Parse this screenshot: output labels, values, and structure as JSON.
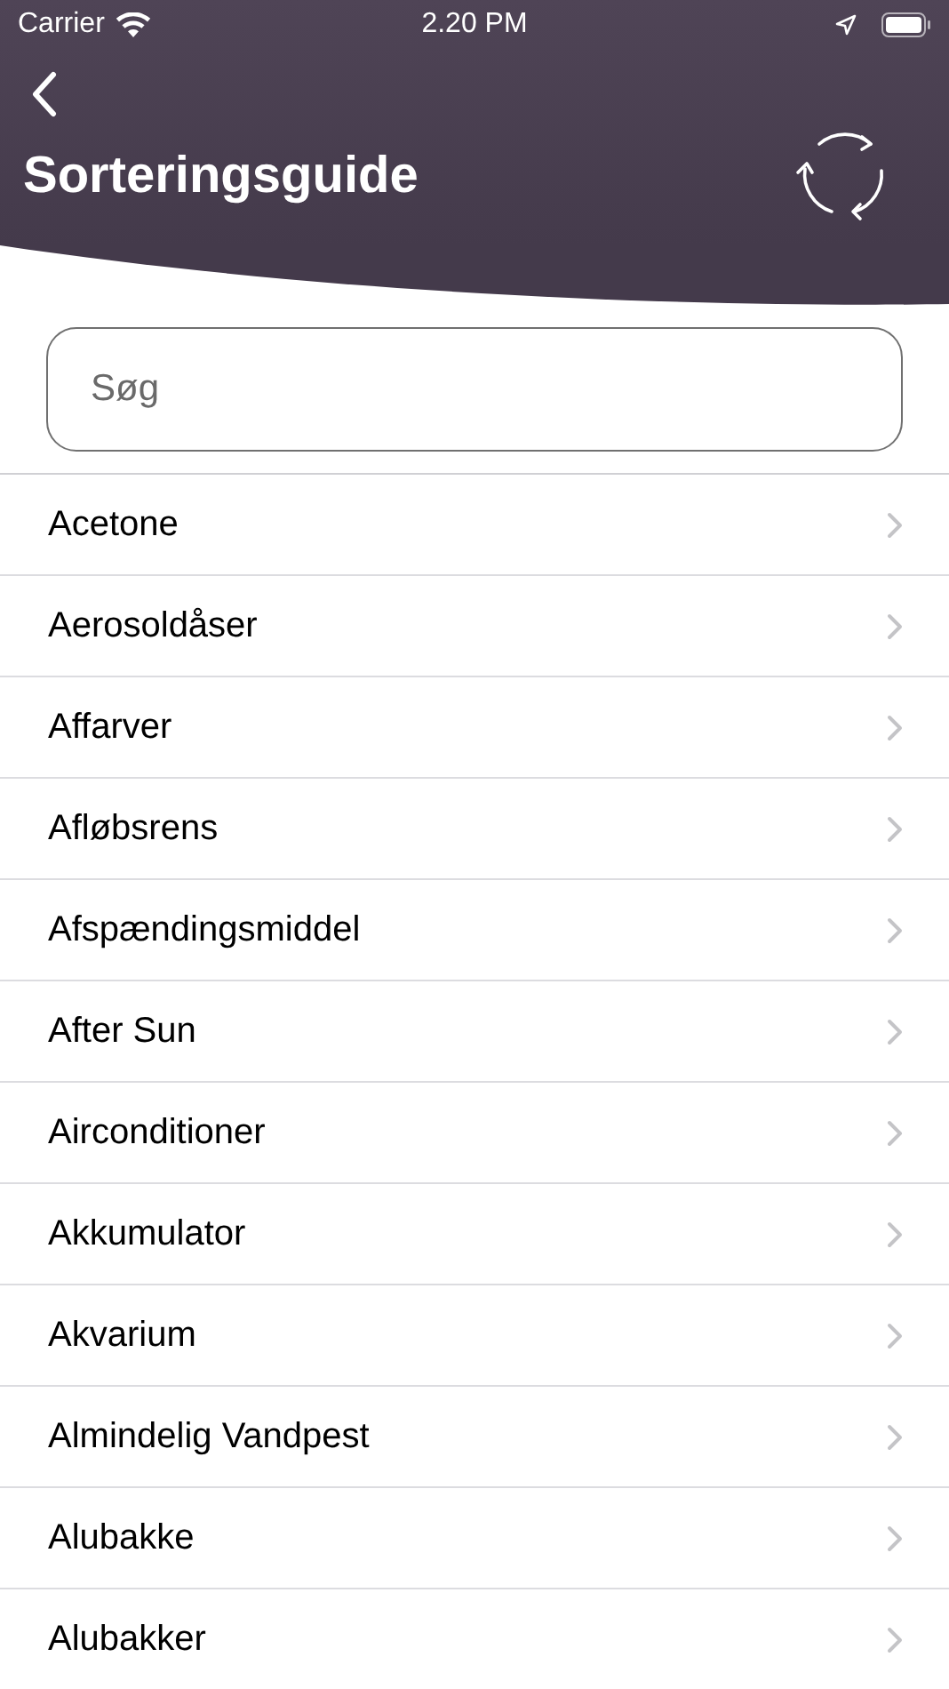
{
  "status_bar": {
    "carrier": "Carrier",
    "time": "2.20 PM"
  },
  "header": {
    "title": "Sorteringsguide"
  },
  "search": {
    "placeholder": "Søg"
  },
  "items": [
    {
      "label": "Acetone"
    },
    {
      "label": "Aerosoldåser"
    },
    {
      "label": "Affarver"
    },
    {
      "label": "Afløbsrens"
    },
    {
      "label": "Afspændingsmiddel"
    },
    {
      "label": "After Sun"
    },
    {
      "label": "Airconditioner"
    },
    {
      "label": "Akkumulator"
    },
    {
      "label": "Akvarium"
    },
    {
      "label": "Almindelig Vandpest"
    },
    {
      "label": "Alubakke"
    },
    {
      "label": "Alubakker"
    }
  ]
}
